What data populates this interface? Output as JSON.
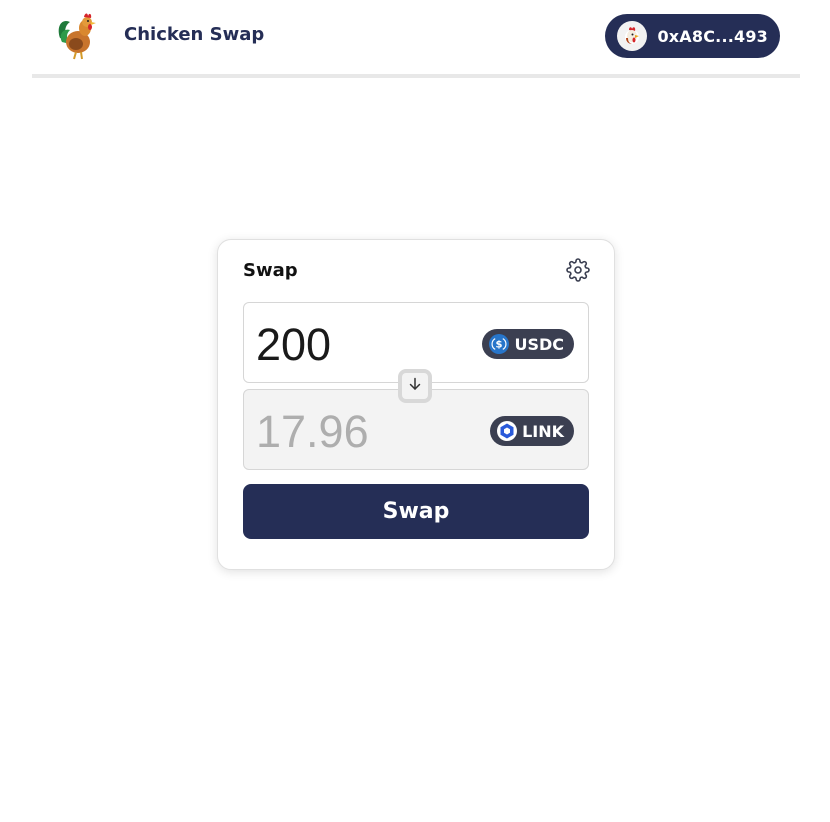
{
  "header": {
    "brand": "Chicken Swap",
    "wallet_address": "0xA8C...493",
    "logo_icon": "rooster-logo",
    "wallet_avatar_icon": "rooster-avatar"
  },
  "swap": {
    "title": "Swap",
    "settings_icon": "gear-icon",
    "from": {
      "amount": "200",
      "token": "USDC",
      "token_icon": "usdc-icon"
    },
    "to": {
      "amount": "17.96",
      "token": "LINK",
      "token_icon": "chainlink-icon"
    },
    "switch_icon": "arrow-down-icon",
    "submit_label": "Swap"
  },
  "colors": {
    "primary": "#252e56",
    "token_pill": "#3b3f51",
    "usdc_blue": "#2775ca",
    "link_blue": "#2a5ada",
    "header_border": "#e8e8e8"
  }
}
